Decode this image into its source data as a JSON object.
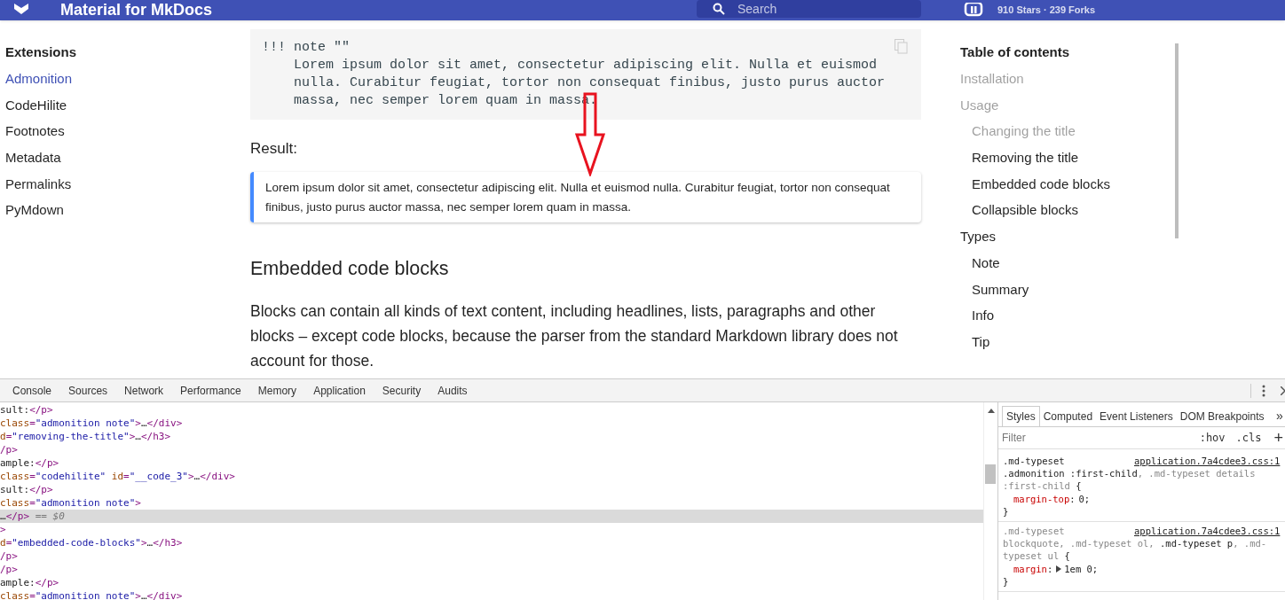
{
  "header": {
    "title": "Material for MkDocs",
    "search_placeholder": "Search",
    "repo_stats": "910 Stars · 239 Forks"
  },
  "nav": {
    "title": "Extensions",
    "items": [
      {
        "label": "Admonition",
        "selected": true
      },
      {
        "label": "CodeHilite",
        "selected": false
      },
      {
        "label": "Footnotes",
        "selected": false
      },
      {
        "label": "Metadata",
        "selected": false
      },
      {
        "label": "Permalinks",
        "selected": false
      },
      {
        "label": "PyMdown",
        "selected": false
      }
    ]
  },
  "content": {
    "code_lines": [
      "!!! note \"\"",
      "    Lorem ipsum dolor sit amet, consectetur adipiscing elit. Nulla et euismod",
      "    nulla. Curabitur feugiat, tortor non consequat finibus, justo purus auctor",
      "    massa, nec semper lorem quam in massa."
    ],
    "result_label": "Result:",
    "admonition_text": "Lorem ipsum dolor sit amet, consectetur adipiscing elit. Nulla et euismod nulla. Curabitur feugiat, tortor non consequat finibus, justo purus auctor massa, nec semper lorem quam in massa.",
    "heading": "Embedded code blocks",
    "paragraph": "Blocks can contain all kinds of text content, including headlines, lists, paragraphs and other blocks – except code blocks, because the parser from the standard Markdown library does not account for those."
  },
  "toc": {
    "title": "Table of contents",
    "items": [
      {
        "label": "Installation",
        "passed": true
      },
      {
        "label": "Usage",
        "passed": true,
        "children": [
          {
            "label": "Changing the title",
            "passed": true
          },
          {
            "label": "Removing the title",
            "passed": false
          },
          {
            "label": "Embedded code blocks",
            "passed": false
          },
          {
            "label": "Collapsible blocks",
            "passed": false
          }
        ]
      },
      {
        "label": "Types",
        "passed": false,
        "children": [
          {
            "label": "Note",
            "passed": false
          },
          {
            "label": "Summary",
            "passed": false
          },
          {
            "label": "Info",
            "passed": false
          },
          {
            "label": "Tip",
            "passed": false
          }
        ]
      }
    ]
  },
  "devtools": {
    "tabs": [
      {
        "label": "Console",
        "selected": false
      },
      {
        "label": "Sources",
        "selected": false
      },
      {
        "label": "Network",
        "selected": false
      },
      {
        "label": "Performance",
        "selected": false
      },
      {
        "label": "Memory",
        "selected": false
      },
      {
        "label": "Application",
        "selected": false
      },
      {
        "label": "Security",
        "selected": false
      },
      {
        "label": "Audits",
        "selected": false
      }
    ],
    "dom_lines": [
      {
        "selected": false,
        "segments": [
          {
            "kind": "text",
            "text": "sult:"
          },
          {
            "kind": "tag",
            "text": "</p>"
          }
        ]
      },
      {
        "selected": false,
        "segments": [
          {
            "kind": "attr",
            "text": "class"
          },
          {
            "kind": "tag",
            "text": "="
          },
          {
            "kind": "value",
            "text": "\"admonition note\""
          },
          {
            "kind": "tag",
            "text": ">"
          },
          {
            "kind": "text",
            "text": "…"
          },
          {
            "kind": "tag",
            "text": "</div>"
          }
        ]
      },
      {
        "selected": false,
        "segments": [
          {
            "kind": "attr",
            "text": "d"
          },
          {
            "kind": "tag",
            "text": "="
          },
          {
            "kind": "value",
            "text": "\"removing-the-title\""
          },
          {
            "kind": "tag",
            "text": ">"
          },
          {
            "kind": "text",
            "text": "…"
          },
          {
            "kind": "tag",
            "text": "</h3>"
          }
        ]
      },
      {
        "selected": false,
        "segments": [
          {
            "kind": "tag",
            "text": "/p>"
          }
        ]
      },
      {
        "selected": false,
        "segments": [
          {
            "kind": "text",
            "text": "ample:"
          },
          {
            "kind": "tag",
            "text": "</p>"
          }
        ]
      },
      {
        "selected": false,
        "segments": [
          {
            "kind": "attr",
            "text": "class"
          },
          {
            "kind": "tag",
            "text": "="
          },
          {
            "kind": "value",
            "text": "\"codehilite\""
          },
          {
            "kind": "attr",
            "text": " id"
          },
          {
            "kind": "tag",
            "text": "="
          },
          {
            "kind": "value",
            "text": "\"__code_3\""
          },
          {
            "kind": "tag",
            "text": ">"
          },
          {
            "kind": "text",
            "text": "…"
          },
          {
            "kind": "tag",
            "text": "</div>"
          }
        ]
      },
      {
        "selected": false,
        "segments": [
          {
            "kind": "text",
            "text": "sult:"
          },
          {
            "kind": "tag",
            "text": "</p>"
          }
        ]
      },
      {
        "selected": false,
        "segments": [
          {
            "kind": "attr",
            "text": "class"
          },
          {
            "kind": "tag",
            "text": "="
          },
          {
            "kind": "value",
            "text": "\"admonition note\""
          },
          {
            "kind": "tag",
            "text": ">"
          }
        ]
      },
      {
        "selected": true,
        "segments": [
          {
            "kind": "text",
            "text": "…"
          },
          {
            "kind": "tag",
            "text": "</p>"
          },
          {
            "kind": "comment",
            "text": " == $0"
          }
        ]
      },
      {
        "selected": false,
        "segments": [
          {
            "kind": "tag",
            "text": ">"
          }
        ]
      },
      {
        "selected": false,
        "segments": [
          {
            "kind": "attr",
            "text": "d"
          },
          {
            "kind": "tag",
            "text": "="
          },
          {
            "kind": "value",
            "text": "\"embedded-code-blocks\""
          },
          {
            "kind": "tag",
            "text": ">"
          },
          {
            "kind": "text",
            "text": "…"
          },
          {
            "kind": "tag",
            "text": "</h3>"
          }
        ]
      },
      {
        "selected": false,
        "segments": [
          {
            "kind": "tag",
            "text": "/p>"
          }
        ]
      },
      {
        "selected": false,
        "segments": [
          {
            "kind": "tag",
            "text": "/p>"
          }
        ]
      },
      {
        "selected": false,
        "segments": [
          {
            "kind": "text",
            "text": "ample:"
          },
          {
            "kind": "tag",
            "text": "</p>"
          }
        ]
      },
      {
        "selected": false,
        "segments": [
          {
            "kind": "attr",
            "text": "class"
          },
          {
            "kind": "tag",
            "text": "="
          },
          {
            "kind": "value",
            "text": "\"admonition note\""
          },
          {
            "kind": "tag",
            "text": ">"
          },
          {
            "kind": "text",
            "text": "…"
          },
          {
            "kind": "tag",
            "text": "</div>"
          }
        ]
      }
    ],
    "side_tabs": [
      {
        "label": "Styles",
        "selected": true
      },
      {
        "label": "Computed",
        "selected": false
      },
      {
        "label": "Event Listeners",
        "selected": false
      },
      {
        "label": "DOM Breakpoints",
        "selected": false
      }
    ],
    "more_tabs": "»",
    "filter_placeholder": "Filter",
    "hov": ":hov",
    "cls": ".cls",
    "add": "+",
    "rules": [
      {
        "source": "application.7a4cdee3.css:1",
        "selector_lines": [
          [
            {
              "text": ".md-typeset",
              "matched": true
            }
          ],
          [
            {
              "text": ".admonition :first-child",
              "matched": true
            },
            {
              "text": ", .md-typeset details",
              "matched": false
            }
          ],
          [
            {
              "text": ":first-child",
              "matched": false
            },
            {
              "text": " {",
              "matched": true
            }
          ]
        ],
        "properties": [
          {
            "name": "margin-top",
            "colon": ":",
            "value": "0;",
            "expandable": false
          }
        ],
        "close": "}"
      },
      {
        "source": "application.7a4cdee3.css:1",
        "selector_lines": [
          [
            {
              "text": ".md-typeset",
              "matched": false
            }
          ],
          [
            {
              "text": "blockquote, .md-typeset ol, ",
              "matched": false
            },
            {
              "text": ".md-typeset p",
              "matched": true
            },
            {
              "text": ", .md-",
              "matched": false
            }
          ],
          [
            {
              "text": "typeset ul",
              "matched": false
            },
            {
              "text": " {",
              "matched": true
            }
          ]
        ],
        "properties": [
          {
            "name": "margin",
            "colon": ":",
            "value": "1em 0;",
            "expandable": true
          }
        ],
        "close": "}"
      }
    ]
  }
}
